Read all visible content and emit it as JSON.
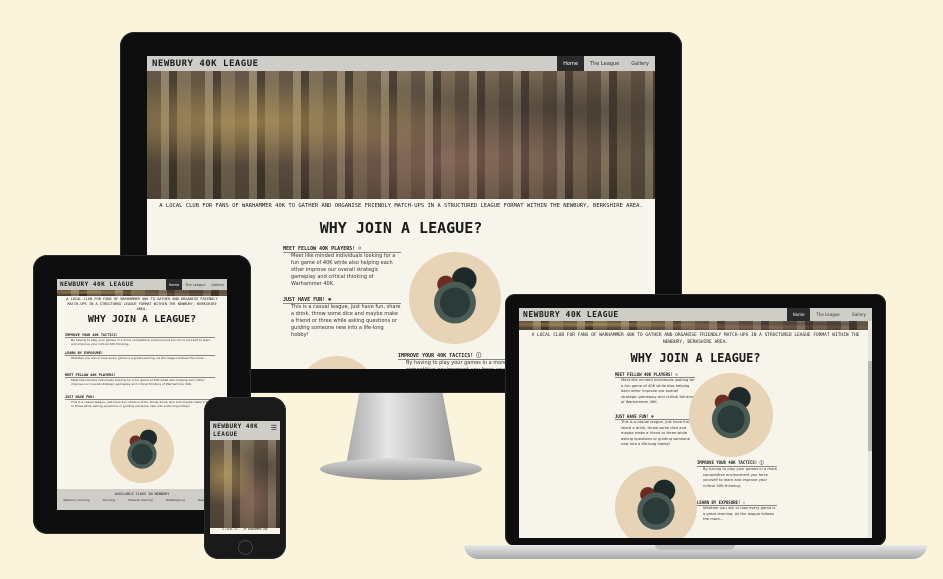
{
  "site": {
    "brand": "NEWBURY 40K LEAGUE",
    "brand_phone_line1": "NEWBURY 40K",
    "brand_phone_line2": "LEAGUE",
    "nav": [
      {
        "label": "Home"
      },
      {
        "label": "The League"
      },
      {
        "label": "Gallery"
      }
    ],
    "tagline": "A LOCAL CLUB FOR FANS OF WARHAMMER 40K TO GATHER AND ORGANISE FRIENDLY MATCH-UPS IN A STRUCTURED LEAGUE FORMAT WITHIN THE NEWBURY, BERKSHIRE AREA.",
    "heading": "WHY JOIN A LEAGUE?",
    "sections": {
      "meet": {
        "title": "MEET FELLOW 40K PLAYERS!",
        "text": "Meet like minded individuals looking for a fun game of 40K while also helping each other improve our overall strategic gameplay and critical thinking of Warhammer 40K."
      },
      "fun": {
        "title": "JUST HAVE FUN!",
        "text": "This is a casual league, just have fun, share a drink, throw some dice and maybe make a friend or three while asking questions or guiding someone new into a life-long hobby!"
      },
      "tactics": {
        "title": "IMPROVE YOUR 40K TACTICS!",
        "text": "By having to play your games in a more competitive environment you force yourself to learn and improve your critical 40K thinking."
      },
      "exposure": {
        "title": "LEARN BY EXPOSURE!",
        "text": "Whether you win or lose every game is a great learning. As the league follows the more..."
      }
    },
    "tablet_footer_title": "AVAILABLE CLASS IN NEWBURY",
    "tablet_footer_items": [
      "Newbury Gaming",
      "Thinking",
      "Wizards Gaming",
      "Tabletopping",
      "Gaslox Gaming"
    ],
    "phone_hero_caption": "A LOCAL CL... OF WARHAMMER 40K"
  },
  "icons": {
    "people": "people-icon",
    "smile": "smile-icon",
    "info": "info-icon",
    "thumbs": "thumbs-up-icon",
    "menu": "hamburger-menu-icon"
  }
}
